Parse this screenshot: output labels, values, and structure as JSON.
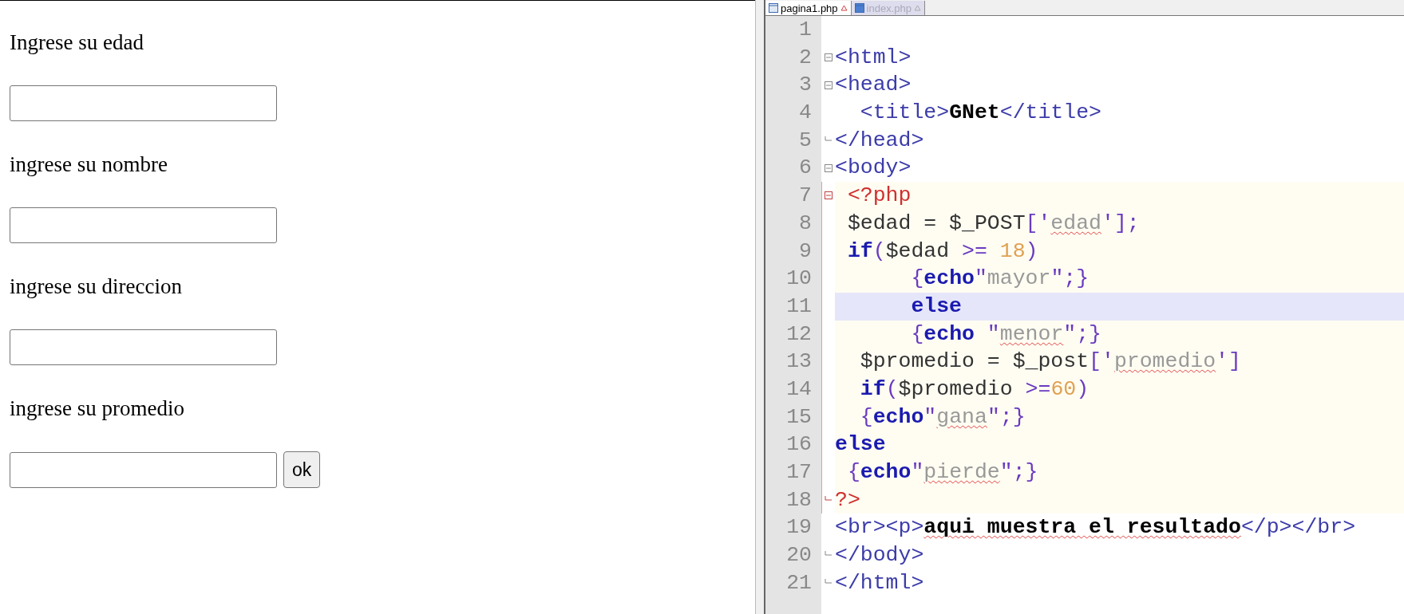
{
  "form": {
    "fields": [
      {
        "label": "Ingrese su edad"
      },
      {
        "label": "ingrese su nombre"
      },
      {
        "label": "ingrese su direccion"
      },
      {
        "label": "ingrese su promedio"
      }
    ],
    "submit": "ok"
  },
  "editor": {
    "tabs": [
      {
        "label": "pagina1.php",
        "selected": true
      },
      {
        "label": "index.php",
        "selected": false
      }
    ],
    "lines": [
      {
        "number": "1",
        "php": false,
        "current": false
      },
      {
        "number": "2",
        "fold_start": true,
        "php": false,
        "current": false,
        "tokens": [
          {
            "kind": "tag",
            "text": "<html>"
          }
        ]
      },
      {
        "number": "3",
        "fold_start": true,
        "php": false,
        "current": false,
        "tokens": [
          {
            "kind": "tag",
            "text": "<head>"
          }
        ]
      },
      {
        "number": "4",
        "php": false,
        "current": false,
        "tokens": [
          {
            "kind": "tag",
            "text": "  <title>"
          },
          {
            "kind": "bold",
            "text": "GNet"
          },
          {
            "kind": "tag",
            "text": "</title>"
          }
        ]
      },
      {
        "number": "5",
        "fold_end": true,
        "php": false,
        "current": false,
        "tokens": [
          {
            "kind": "tag",
            "text": "</head>"
          }
        ]
      },
      {
        "number": "6",
        "fold_start": true,
        "php": false,
        "current": false,
        "tokens": [
          {
            "kind": "tag",
            "text": "<body>"
          }
        ]
      },
      {
        "number": "7",
        "fold_start": true,
        "php": true,
        "current": false,
        "tokens": [
          {
            "kind": "php",
            "text": " <?php"
          }
        ]
      },
      {
        "number": "8",
        "php": true,
        "current": false,
        "tokens": [
          {
            "kind": "plain",
            "text": " $edad = $_POST"
          },
          {
            "kind": "punct",
            "text": "['"
          },
          {
            "kind": "str",
            "text": "edad",
            "spell_error": true
          },
          {
            "kind": "punct",
            "text": "'];"
          }
        ]
      },
      {
        "number": "9",
        "php": true,
        "current": false,
        "tokens": [
          {
            "kind": "kw",
            "text": " if"
          },
          {
            "kind": "punct",
            "text": "("
          },
          {
            "kind": "plain",
            "text": "$edad "
          },
          {
            "kind": "punct",
            "text": ">= "
          },
          {
            "kind": "num",
            "text": "18"
          },
          {
            "kind": "punct",
            "text": ")"
          }
        ]
      },
      {
        "number": "10",
        "php": true,
        "current": false,
        "tokens": [
          {
            "kind": "punct",
            "text": "      {"
          },
          {
            "kind": "kw",
            "text": "echo"
          },
          {
            "kind": "punct",
            "text": "\""
          },
          {
            "kind": "str",
            "text": "mayor"
          },
          {
            "kind": "punct",
            "text": "\";}"
          }
        ]
      },
      {
        "number": "11",
        "php": true,
        "current": true,
        "tokens": [
          {
            "kind": "kw",
            "text": "      else"
          }
        ]
      },
      {
        "number": "12",
        "php": true,
        "current": false,
        "tokens": [
          {
            "kind": "punct",
            "text": "      {"
          },
          {
            "kind": "kw",
            "text": "echo"
          },
          {
            "kind": "punct",
            "text": " \""
          },
          {
            "kind": "str",
            "text": "menor",
            "spell_error": true
          },
          {
            "kind": "punct",
            "text": "\";}"
          }
        ]
      },
      {
        "number": "13",
        "php": true,
        "current": false,
        "tokens": [
          {
            "kind": "plain",
            "text": "  $promedio = $_post"
          },
          {
            "kind": "punct",
            "text": "['"
          },
          {
            "kind": "str",
            "text": "promedio",
            "spell_error": true
          },
          {
            "kind": "punct",
            "text": "']"
          }
        ]
      },
      {
        "number": "14",
        "php": true,
        "current": false,
        "tokens": [
          {
            "kind": "kw",
            "text": "  if"
          },
          {
            "kind": "punct",
            "text": "("
          },
          {
            "kind": "plain",
            "text": "$promedio "
          },
          {
            "kind": "punct",
            "text": ">="
          },
          {
            "kind": "num",
            "text": "60"
          },
          {
            "kind": "punct",
            "text": ")"
          }
        ]
      },
      {
        "number": "15",
        "php": true,
        "current": false,
        "tokens": [
          {
            "kind": "punct",
            "text": "  {"
          },
          {
            "kind": "kw",
            "text": "echo"
          },
          {
            "kind": "punct",
            "text": "\""
          },
          {
            "kind": "str",
            "text": "gana",
            "spell_error": true
          },
          {
            "kind": "punct",
            "text": "\";}"
          }
        ]
      },
      {
        "number": "16",
        "php": true,
        "current": false,
        "tokens": [
          {
            "kind": "kw",
            "text": "else"
          }
        ]
      },
      {
        "number": "17",
        "php": true,
        "current": false,
        "tokens": [
          {
            "kind": "punct",
            "text": " {"
          },
          {
            "kind": "kw",
            "text": "echo"
          },
          {
            "kind": "punct",
            "text": "\""
          },
          {
            "kind": "str",
            "text": "pierde",
            "spell_error": true
          },
          {
            "kind": "punct",
            "text": "\";}"
          }
        ]
      },
      {
        "number": "18",
        "fold_end": true,
        "php": true,
        "current": false,
        "tokens": [
          {
            "kind": "php",
            "text": "?>"
          }
        ]
      },
      {
        "number": "19",
        "php": false,
        "current": false,
        "tokens": [
          {
            "kind": "tag",
            "text": "<br><p>"
          },
          {
            "kind": "bold",
            "text": "aqui muestra el resultado",
            "spell_error": true
          },
          {
            "kind": "tag",
            "text": "</p></br>"
          }
        ]
      },
      {
        "number": "20",
        "fold_end": true,
        "php": false,
        "current": false,
        "tokens": [
          {
            "kind": "tag",
            "text": "</body>"
          }
        ]
      },
      {
        "number": "21",
        "fold_end": true,
        "php": false,
        "current": false,
        "tokens": [
          {
            "kind": "tag",
            "text": "</html>"
          }
        ]
      }
    ]
  }
}
